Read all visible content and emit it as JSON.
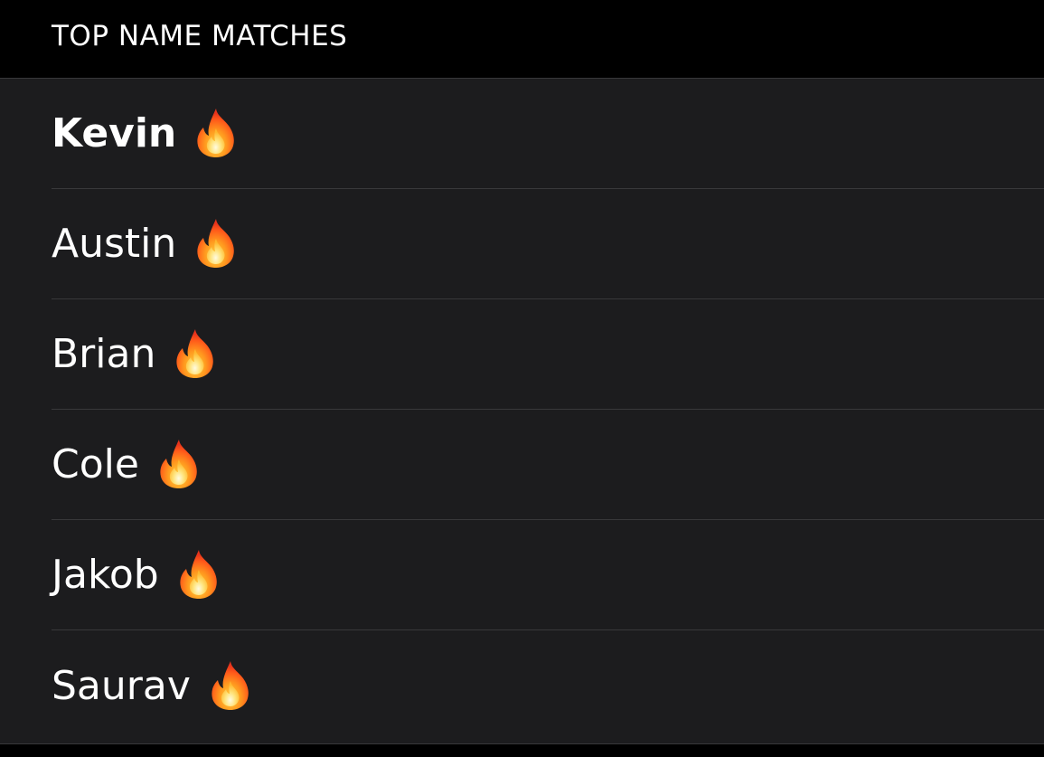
{
  "section": {
    "title": "TOP NAME MATCHES"
  },
  "matches": [
    {
      "name": "Kevin",
      "icon": "fire-icon",
      "selected": true
    },
    {
      "name": "Austin",
      "icon": "fire-icon",
      "selected": false
    },
    {
      "name": "Brian",
      "icon": "fire-icon",
      "selected": false
    },
    {
      "name": "Cole",
      "icon": "fire-icon",
      "selected": false
    },
    {
      "name": "Jakob",
      "icon": "fire-icon",
      "selected": false
    },
    {
      "name": "Saurav",
      "icon": "fire-icon",
      "selected": false
    }
  ],
  "colors": {
    "background": "#000000",
    "list_background": "#1c1c1e",
    "separator": "#38383a",
    "text": "#ffffff"
  }
}
